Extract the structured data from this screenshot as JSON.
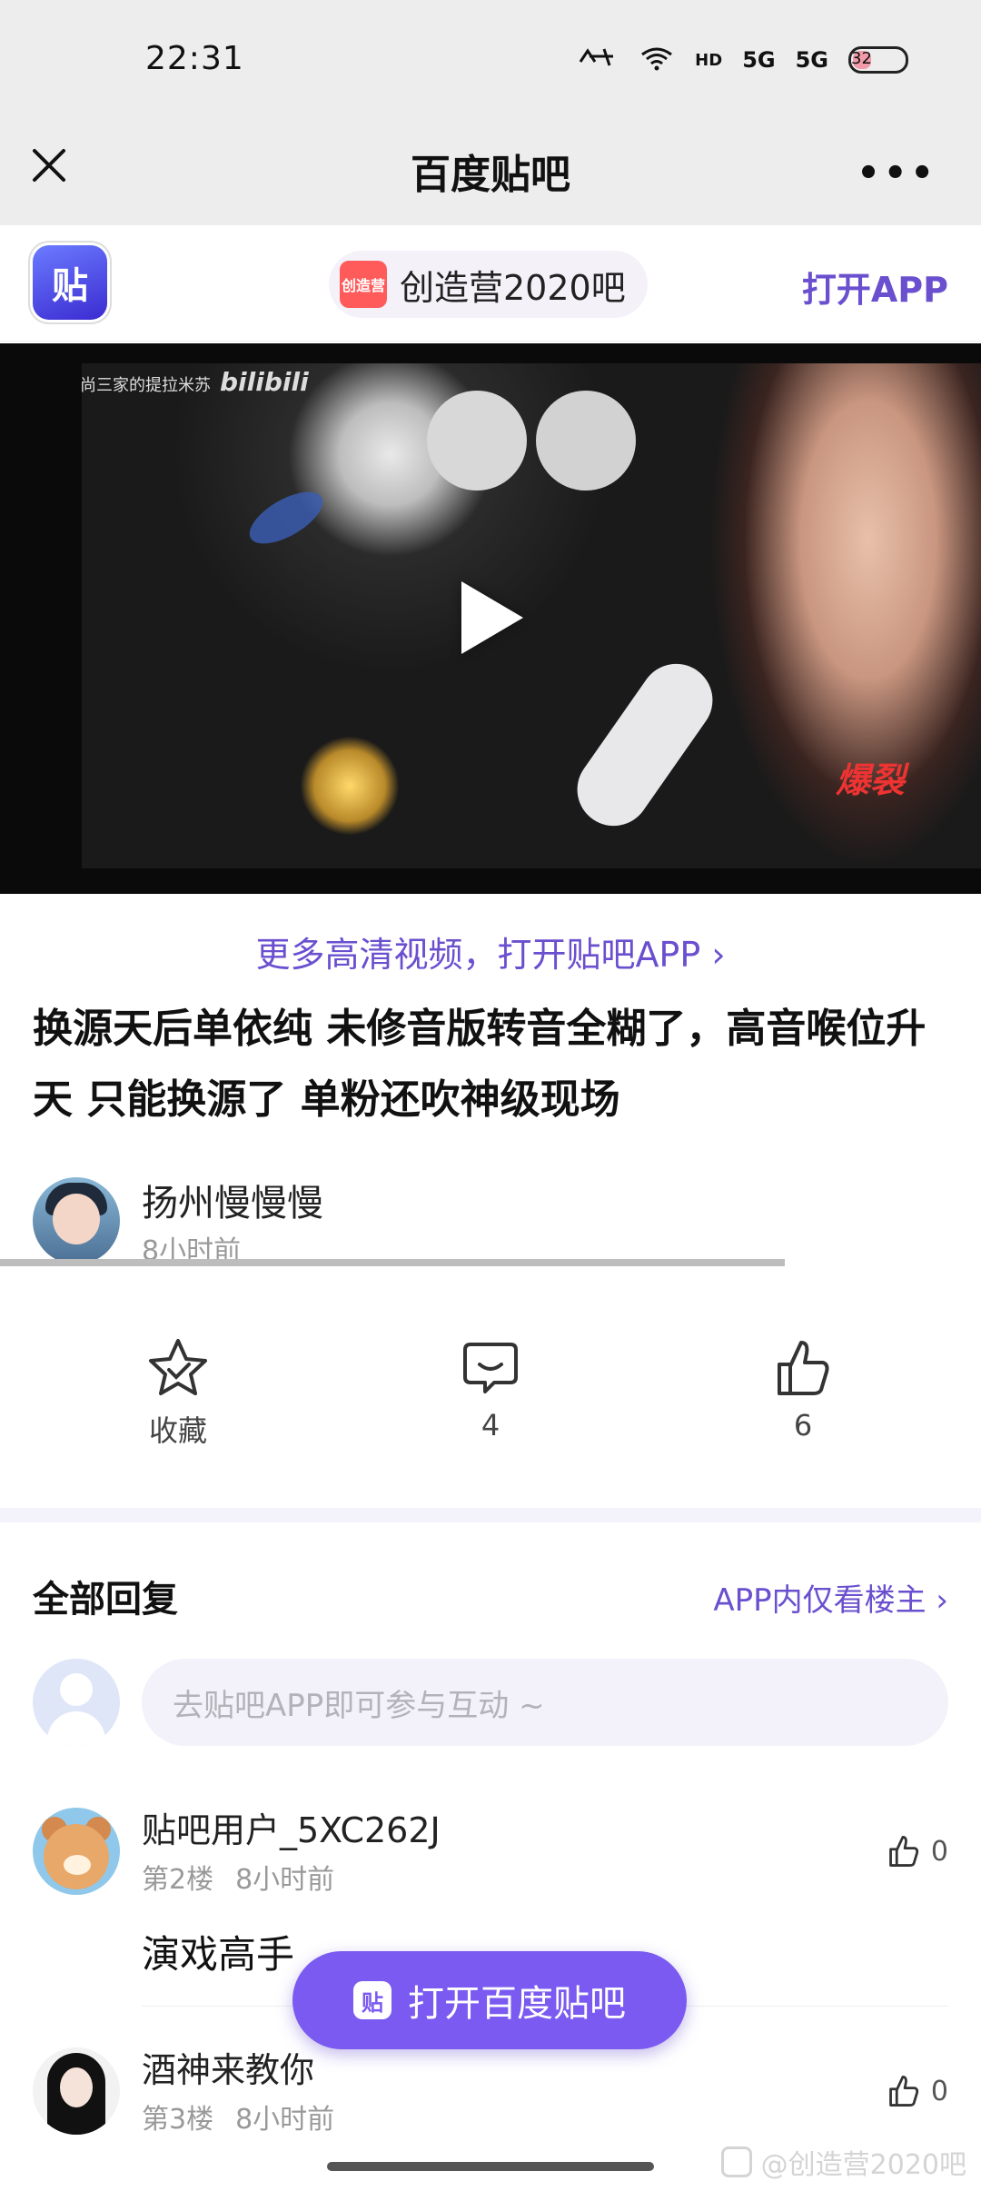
{
  "status_bar": {
    "time": "22:31",
    "icons": [
      "mute-icon",
      "wifi-icon",
      "hd-signal-icon",
      "5g-signal-icon",
      "5g-signal-icon"
    ],
    "hd_label": "HD",
    "net1": "5G",
    "net2": "5G",
    "battery": "32"
  },
  "nav": {
    "title": "百度贴吧",
    "more": "•••"
  },
  "promo": {
    "app_logo_text": "贴",
    "forum_icon_text": "创造营",
    "forum_name": "创造营2020吧",
    "open_app": "打开APP"
  },
  "video": {
    "watermark": "尚三家的提拉米苏",
    "watermark_brand": "bilibili",
    "corner_text": "爆裂"
  },
  "post": {
    "more_hd": "更多高清视频，打开贴吧APP ›",
    "title": "换源天后单依纯 未修音版转音全糊了，高音喉位升天 只能换源了 单粉还吹神级现场",
    "author": "扬州慢慢慢",
    "time": "8小时前",
    "video_progress": 0.8
  },
  "actions": {
    "favorite_label": "收藏",
    "comment_count": "4",
    "like_count": "6"
  },
  "replies": {
    "title": "全部回复",
    "only_owner": "APP内仅看楼主 ›",
    "input_placeholder": "去贴吧APP即可参与互动 ~",
    "items": [
      {
        "user": "贴吧用户_5XC262J",
        "floor": "第2楼",
        "time": "8小时前",
        "content": "演戏高手",
        "likes": "0"
      },
      {
        "user": "酒神来教你",
        "floor": "第3楼",
        "time": "8小时前",
        "content": "",
        "likes": "0"
      }
    ]
  },
  "float_button": {
    "icon_text": "贴",
    "label": "打开百度贴吧"
  },
  "bottom_watermark": "@创造营2020吧",
  "colors": {
    "accent": "#6a4fcf",
    "button": "#7a5af0",
    "topbar": "#ededed"
  }
}
